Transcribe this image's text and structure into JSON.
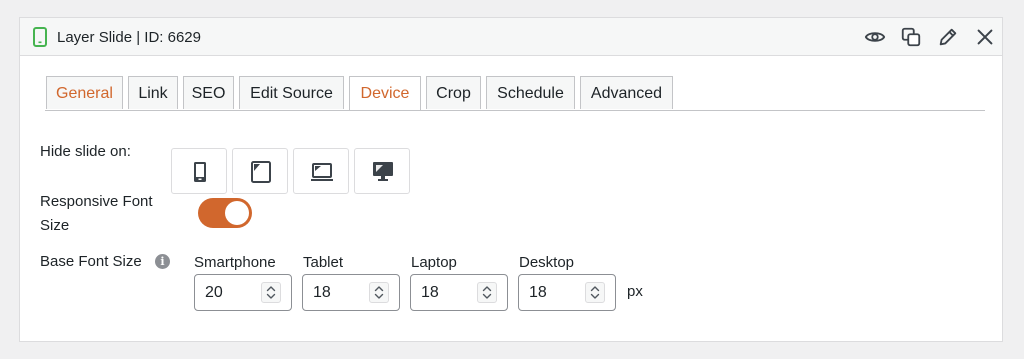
{
  "header": {
    "title": "Layer Slide | ID: 6629",
    "icons": [
      "phone-icon",
      "eye-icon",
      "duplicate-icon",
      "pencil-icon",
      "close-icon"
    ]
  },
  "tabs": [
    {
      "label": "General",
      "state": "highlighted"
    },
    {
      "label": "Link",
      "state": "normal"
    },
    {
      "label": "SEO",
      "state": "normal"
    },
    {
      "label": "Edit Source",
      "state": "normal"
    },
    {
      "label": "Device",
      "state": "active"
    },
    {
      "label": "Crop",
      "state": "normal"
    },
    {
      "label": "Schedule",
      "state": "normal"
    },
    {
      "label": "Advanced",
      "state": "normal"
    }
  ],
  "hide_slide": {
    "label": "Hide slide on:",
    "devices": [
      "smartphone-icon",
      "tablet-icon",
      "laptop-icon",
      "desktop-icon"
    ]
  },
  "responsive_font": {
    "label_line1": "Responsive Font",
    "label_line2": "Size",
    "enabled": true
  },
  "base_font": {
    "label": "Base Font Size",
    "unit": "px",
    "fields": [
      {
        "label": "Smartphone",
        "value": "20"
      },
      {
        "label": "Tablet",
        "value": "18"
      },
      {
        "label": "Laptop",
        "value": "18"
      },
      {
        "label": "Desktop",
        "value": "18"
      }
    ]
  },
  "colors": {
    "accent": "#d1672d",
    "toggle_on": "#d1672d",
    "phone_icon": "#46b450"
  }
}
